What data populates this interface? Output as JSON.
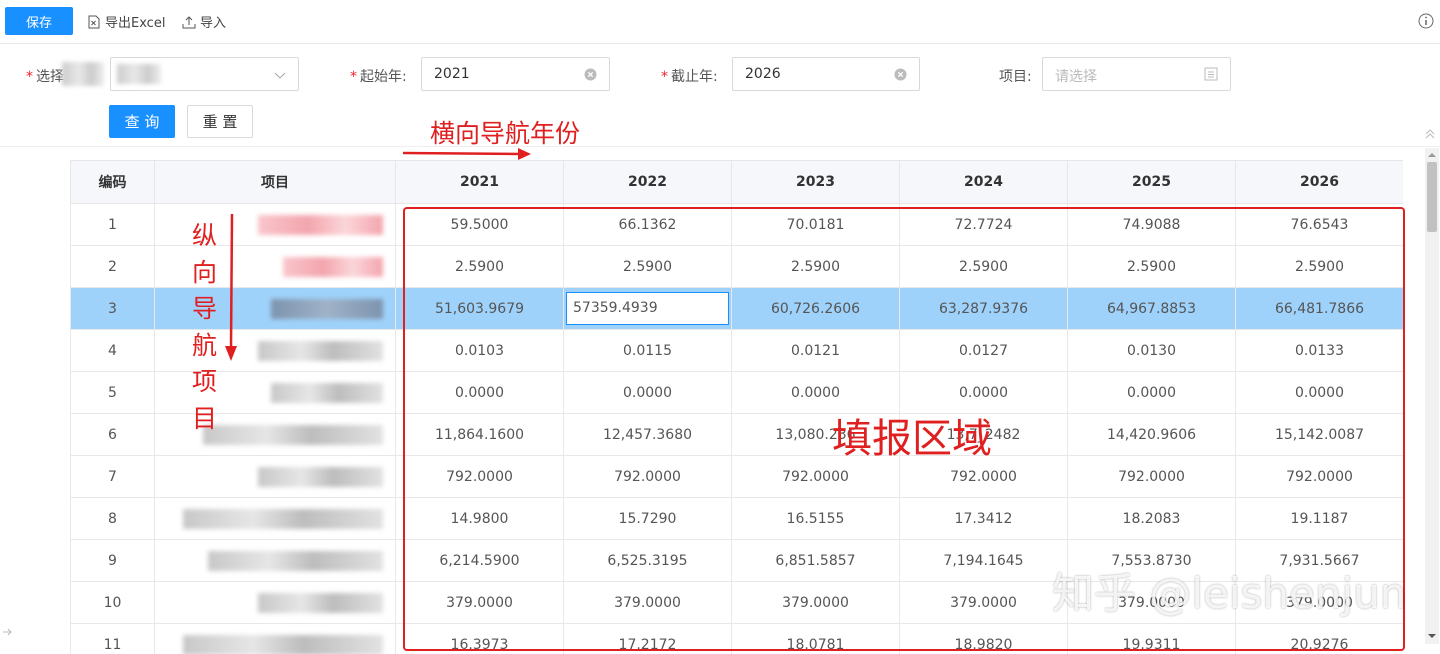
{
  "toolbar": {
    "save_label": "保存",
    "export_label": "导出Excel",
    "import_label": "导入"
  },
  "filters": {
    "select_label": "选择",
    "start_year_label": "起始年:",
    "start_year_value": "2021",
    "end_year_label": "截止年:",
    "end_year_value": "2026",
    "project_label": "项目:",
    "project_placeholder": "请选择"
  },
  "actions": {
    "query_label": "查 询",
    "reset_label": "重 置"
  },
  "table": {
    "headers": [
      "编码",
      "项目",
      "2021",
      "2022",
      "2023",
      "2024",
      "2025",
      "2026"
    ],
    "selected_row_index": 2,
    "editing_value": "57359.4939",
    "rows": [
      {
        "code": "1",
        "values": [
          "59.5000",
          "66.1362",
          "70.0181",
          "72.7724",
          "74.9088",
          "76.6543"
        ]
      },
      {
        "code": "2",
        "values": [
          "2.5900",
          "2.5900",
          "2.5900",
          "2.5900",
          "2.5900",
          "2.5900"
        ]
      },
      {
        "code": "3",
        "values": [
          "51,603.9679",
          "57359.4939",
          "60,726.2606",
          "63,287.9376",
          "64,967.8853",
          "66,481.7866"
        ]
      },
      {
        "code": "4",
        "values": [
          "0.0103",
          "0.0115",
          "0.0121",
          "0.0127",
          "0.0130",
          "0.0133"
        ]
      },
      {
        "code": "5",
        "values": [
          "0.0000",
          "0.0000",
          "0.0000",
          "0.0000",
          "0.0000",
          "0.0000"
        ]
      },
      {
        "code": "6",
        "values": [
          "11,864.1600",
          "12,457.3680",
          "13,080.236",
          "13,7_2482",
          "14,420.9606",
          "15,142.0087"
        ]
      },
      {
        "code": "7",
        "values": [
          "792.0000",
          "792.0000",
          "792.0000",
          "792.0000",
          "792.0000",
          "792.0000"
        ]
      },
      {
        "code": "8",
        "values": [
          "14.9800",
          "15.7290",
          "16.5155",
          "17.3412",
          "18.2083",
          "19.1187"
        ]
      },
      {
        "code": "9",
        "values": [
          "6,214.5900",
          "6,525.3195",
          "6,851.5857",
          "7,194.1645",
          "7,553.8730",
          "7,931.5667"
        ]
      },
      {
        "code": "10",
        "values": [
          "379.0000",
          "379.0000",
          "379.0000",
          "379.0000",
          "379.0000",
          "379.0000"
        ]
      },
      {
        "code": "11",
        "values": [
          "16.3973",
          "17.2172",
          "18.0781",
          "18.9820",
          "19.9311",
          "20.9276"
        ]
      }
    ]
  },
  "annotations": {
    "horizontal_nav": "横向导航年份",
    "vertical_nav": "纵向导航项目",
    "fill_area": "填报区域",
    "color": "#e02020"
  },
  "watermark": "知乎 @leishenjun",
  "colors": {
    "primary": "#1890ff",
    "selected_row": "#9fd2fb",
    "required": "#f5222d"
  }
}
